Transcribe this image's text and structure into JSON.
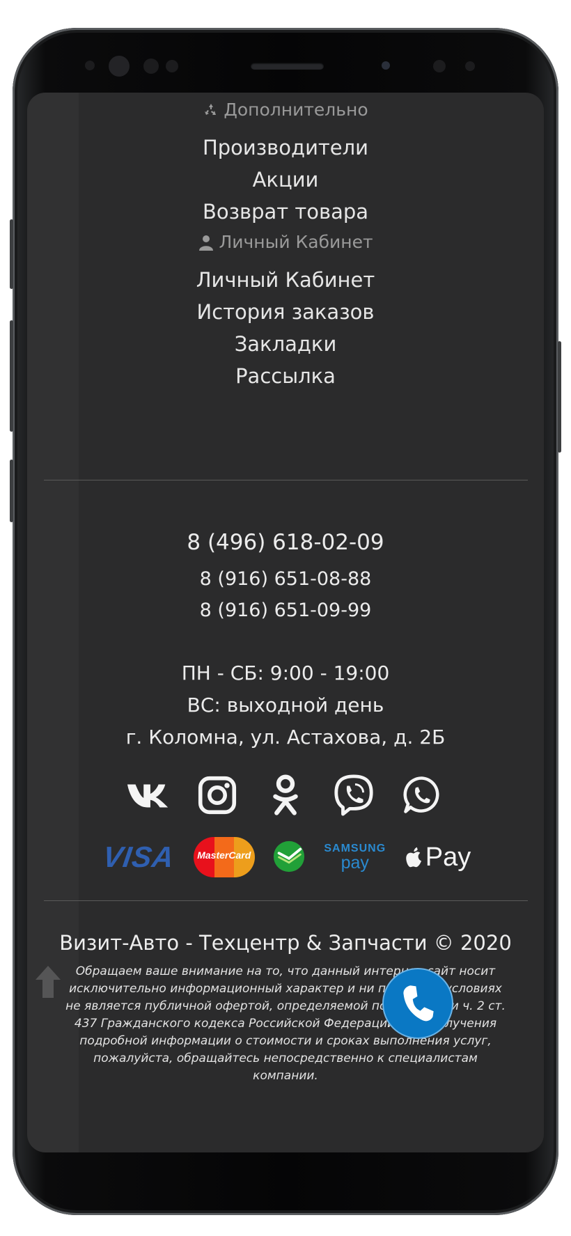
{
  "sections": {
    "additional": {
      "title": "Дополнительно",
      "items": [
        "Производители",
        "Акции",
        "Возврат товара"
      ]
    },
    "account": {
      "title": "Личный Кабинет",
      "items": [
        "Личный Кабинет",
        "История заказов",
        "Закладки",
        "Рассылка"
      ]
    }
  },
  "contacts": {
    "phone_main": "8 (496) 618-02-09",
    "phone_2": "8 (916) 651-08-88",
    "phone_3": "8 (916) 651-09-99",
    "hours": "ПН - СБ: 9:00 - 19:00",
    "day_off": "ВС: выходной день",
    "address": "г. Коломна, ул. Астахова, д. 2Б"
  },
  "social_icons": [
    "vk-icon",
    "instagram-icon",
    "odnoklassniki-icon",
    "viber-icon",
    "whatsapp-icon"
  ],
  "payments": {
    "visa": "VISA",
    "mastercard": "MasterCard",
    "samsung_top": "SAMSUNG",
    "samsung_bottom": "pay",
    "apple": "Pay"
  },
  "footer": {
    "copyright": "Визит-Авто - Техцентр & Запчасти © 2020",
    "disclaimer": "Обращаем ваше внимание на то, что данный интернет-сайт носит исключительно информационный характер и ни при каких условиях не является публичной офертой, определяемой положениями ч. 2 ст. 437 Гражданского кодекса Российской Федерации. Для получения подробной информации о стоимости и сроках выполнения услуг, пожалуйста, обращайтесь непосредственно к специалистам компании."
  },
  "colors": {
    "background": "#2b2b2c",
    "text": "#e8e8e8",
    "muted": "#9a9a9a",
    "call_button": "#0a78c4"
  }
}
